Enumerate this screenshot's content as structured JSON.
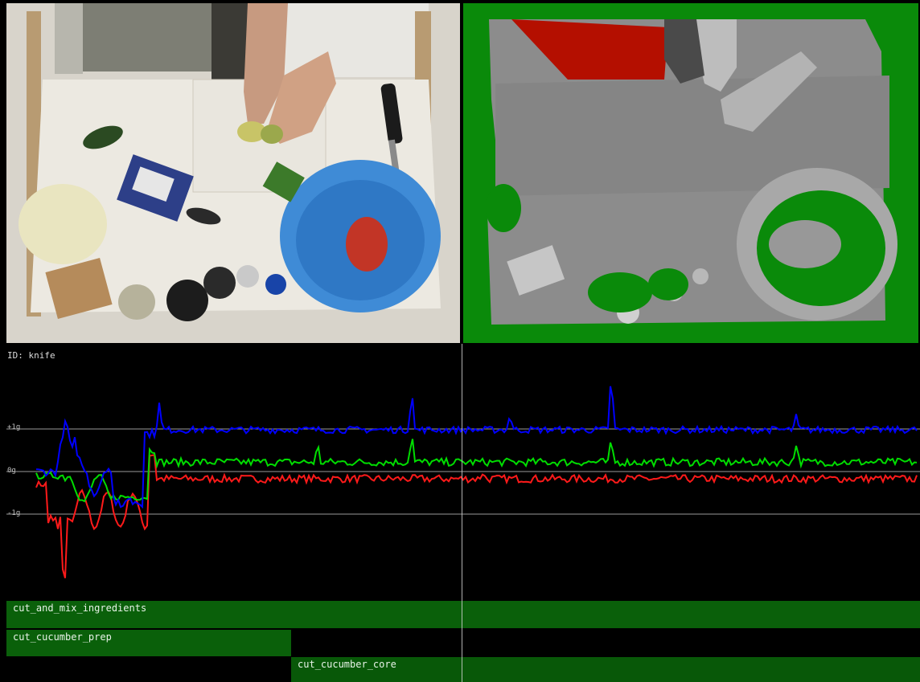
{
  "sensor": {
    "id_label": "ID: knife",
    "axis_labels": {
      "plus": "+1g",
      "zero": "0g",
      "minus": "-1g"
    }
  },
  "activities": [
    {
      "label": "cut_and_mix_ingredients"
    },
    {
      "label": "cut_cucumber_prep"
    },
    {
      "label": "cut_cucumber_core"
    }
  ],
  "colors": {
    "series_x": "#0000ff",
    "series_y": "#00dd00",
    "series_z": "#ff1a1a",
    "track_active": "#0a600a",
    "depth_background": "#0a8a0a",
    "depth_highlight": "#b40f00"
  }
}
